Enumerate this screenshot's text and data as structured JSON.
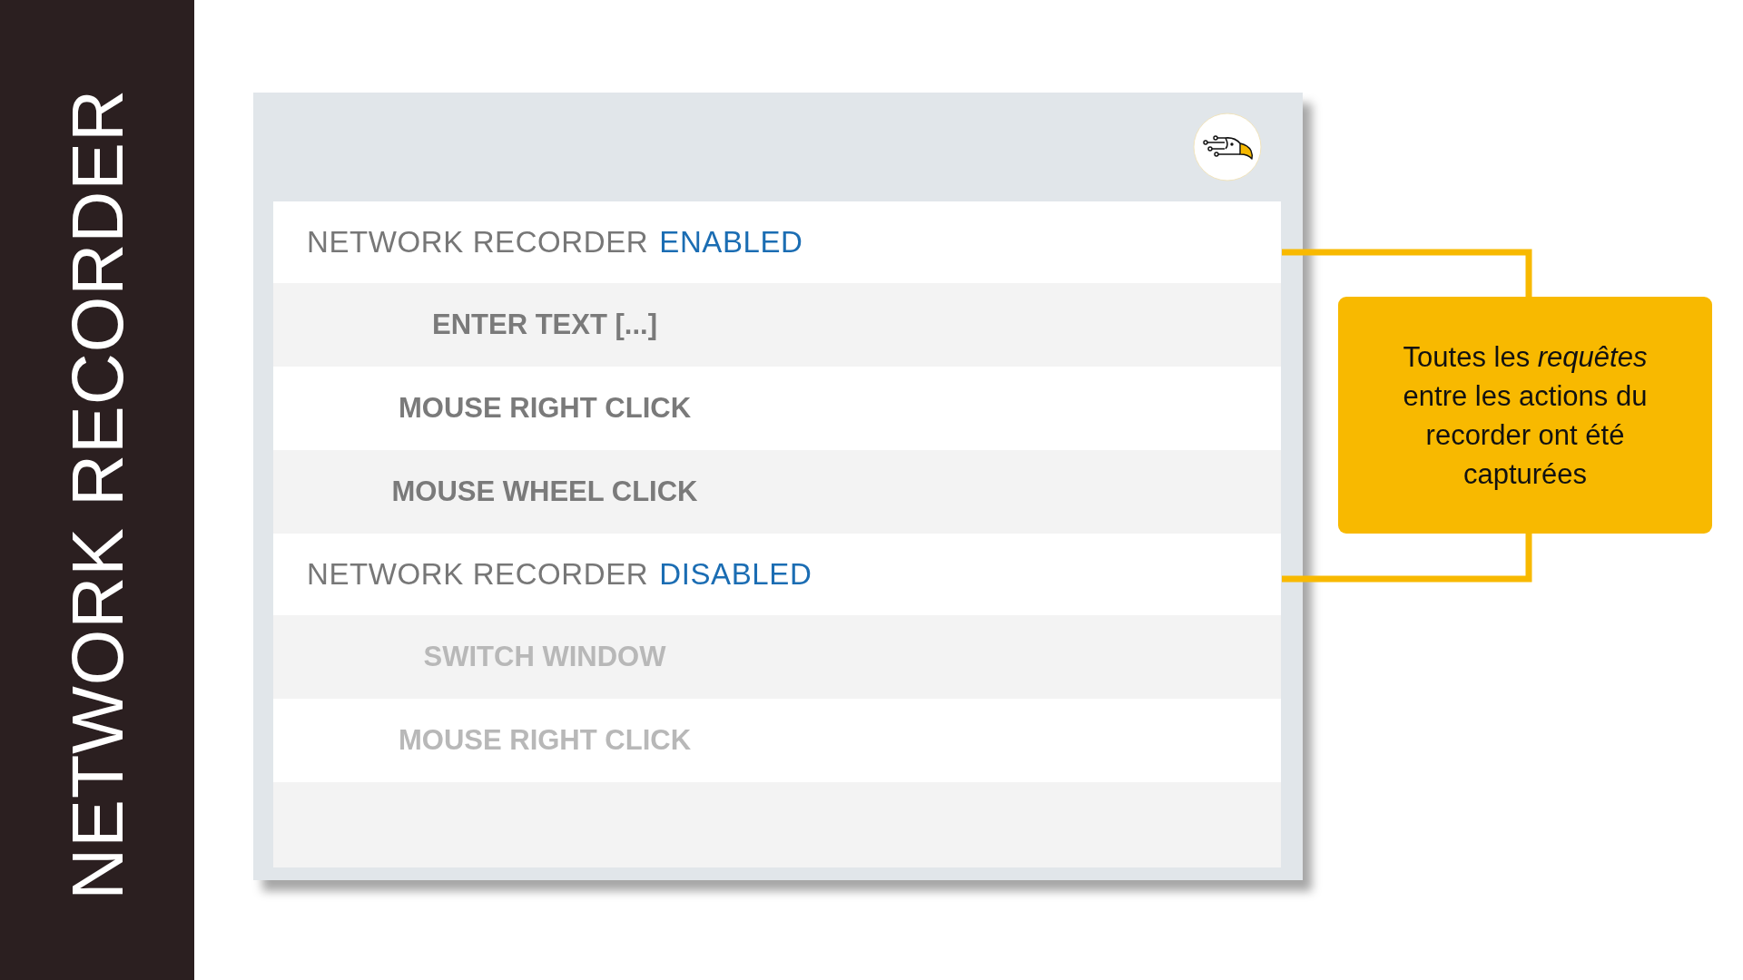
{
  "sidebar": {
    "title": "NETWORK RECORDER"
  },
  "panel": {
    "sections": [
      {
        "title": "NETWORK RECORDER",
        "status": "ENABLED",
        "actions": [
          {
            "label": "ENTER TEXT [...]",
            "disabled": false
          },
          {
            "label": "MOUSE RIGHT CLICK",
            "disabled": false
          },
          {
            "label": "MOUSE WHEEL CLICK",
            "disabled": false
          }
        ]
      },
      {
        "title": "NETWORK RECORDER",
        "status": "DISABLED",
        "actions": [
          {
            "label": "SWITCH WINDOW",
            "disabled": true
          },
          {
            "label": "MOUSE RIGHT CLICK",
            "disabled": true
          }
        ]
      }
    ]
  },
  "callout": {
    "text": "Toutes les *requêtes* entre les actions du recorder ont été capturées"
  }
}
